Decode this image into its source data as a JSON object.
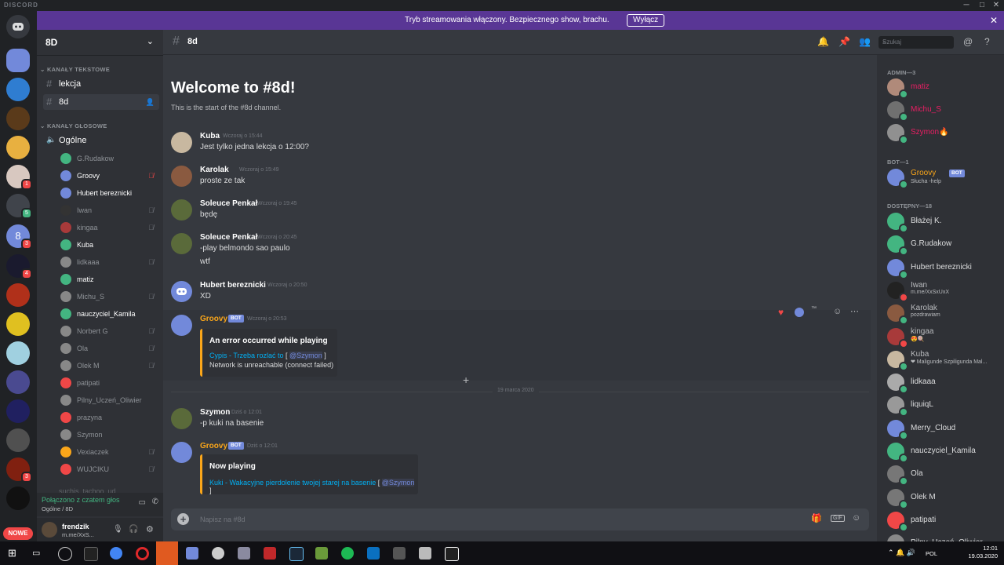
{
  "window": {
    "app_name": "DISCORD",
    "controls": [
      "─",
      "□",
      "✕"
    ]
  },
  "banner": {
    "text": "Tryb streamowania włączony. Bezpiecznego show, brachu.",
    "button": "Wyłącz",
    "close": "✕"
  },
  "servers": {
    "badges": {
      "s4": "1",
      "s5": "5",
      "s6": "3",
      "s7": "4",
      "s14": "3"
    },
    "active_label": "8",
    "nowe": "NOWE"
  },
  "guild": {
    "name": "8D",
    "categories": {
      "text": "KANAŁY TEKSTOWE",
      "voice": "KANAŁY GŁOSOWE"
    },
    "text_channels": [
      "lekcja",
      "8d"
    ],
    "voice_channel": "Ogólne",
    "voice_users": [
      "G.Rudakow",
      "Groovy",
      "Hubert bereznicki",
      "Iwan",
      "kingaa",
      "Kuba",
      "lidkaaa",
      "matiz",
      "Michu_S",
      "nauczyciel_Kamila",
      "Norbert G",
      "Ola",
      "Olek M",
      "patipati",
      "Pilny_Uczeń_Oliwier",
      "prazyna",
      "Szymon",
      "Vexiaczek",
      "WUJCIKU"
    ],
    "next_channel_partial": "suchis_tachoo_ud"
  },
  "voice_status": {
    "status": "Połączono z czatem głos",
    "location": "Ogólne / 8D"
  },
  "user_panel": {
    "name": "frendzik",
    "status": "m.me/XxS..."
  },
  "chat": {
    "channel": "8d",
    "search_placeholder": "Szukaj",
    "welcome_title": "Welcome to #8d!",
    "welcome_sub": "This is the start of the #8d channel.",
    "messages": [
      {
        "author": "Kuba",
        "time": "Wczoraj o 15:44",
        "lines": [
          "Jest tylko jedna lekcja o 12:00?"
        ]
      },
      {
        "author": "Karolak",
        "time": "Wczoraj o 15:49",
        "lines": [
          "proste ze tak"
        ]
      },
      {
        "author": "Soleuce Penkał",
        "time": "Wczoraj o 19:45",
        "lines": [
          "będę"
        ]
      },
      {
        "author": "Soleuce Penkał",
        "time": "Wczoraj o 20:45",
        "lines": [
          "-play belmondo sao paulo",
          "wtf"
        ]
      },
      {
        "author": "Hubert bereznicki",
        "time": "Wczoraj o 20:50",
        "lines": [
          "XD"
        ]
      },
      {
        "author": "Groovy",
        "bot_tag": "BOT",
        "time": "Wczoraj o 20:53",
        "embed": {
          "title": "An error occurred while playing",
          "link": "Cypis - Trzeba rozlać to",
          "mention": "@Szymon",
          "detail": "Network is unreachable (connect failed)"
        }
      },
      {
        "author": "Szymon",
        "time": "Dziś o 12:01",
        "lines": [
          "-p kuki na basenie"
        ]
      },
      {
        "author": "Groovy",
        "bot_tag": "BOT",
        "time": "Dziś o 12:01",
        "embed": {
          "title": "Now playing",
          "link": "Kuki - Wakacyjne pierdolenie twojej starej na basenie",
          "mention": "@Szymon"
        }
      }
    ],
    "date_divider": "19 marca 2020",
    "reaction_tm": "™",
    "composer_placeholder": "Napisz na #8d"
  },
  "members": {
    "admin_header": "ADMIN—3",
    "admins": [
      {
        "name": "matiz",
        "color": "#e91e63"
      },
      {
        "name": "Michu_S",
        "color": "#e91e63"
      },
      {
        "name": "Szymon🔥",
        "color": "#e91e63"
      }
    ],
    "bot_header": "BOT—1",
    "bots": [
      {
        "name": "Groovy",
        "tag": "BOT",
        "activity": "Słucha -help",
        "color": "#faa61a"
      }
    ],
    "online_header": "DOSTĘPNY—18",
    "online": [
      {
        "name": "Błażej K."
      },
      {
        "name": "G.Rudakow"
      },
      {
        "name": "Hubert bereznicki"
      },
      {
        "name": "Iwan",
        "activity": "m.me/XxSxUxX"
      },
      {
        "name": "Karolak",
        "activity": "pozdrawiam"
      },
      {
        "name": "kingaa",
        "activity": "😍🍭"
      },
      {
        "name": "Kuba",
        "activity": "❤ Maligunde Szpiligunda Mal..."
      },
      {
        "name": "lidkaaa"
      },
      {
        "name": "liquiqL"
      },
      {
        "name": "Merry_Cloud"
      },
      {
        "name": "nauczyciel_Kamila"
      },
      {
        "name": "Ola"
      },
      {
        "name": "Olek M"
      },
      {
        "name": "patipati"
      },
      {
        "name": "Pilny_Uczeń_Oliwier"
      }
    ]
  },
  "taskbar": {
    "lang": "POL",
    "time": "12:01",
    "date": "19.03.2020"
  },
  "colors": {
    "blurple": "#7289da",
    "online": "#43b581",
    "dnd": "#f04747",
    "idle": "#faa61a",
    "banner": "#593695"
  }
}
